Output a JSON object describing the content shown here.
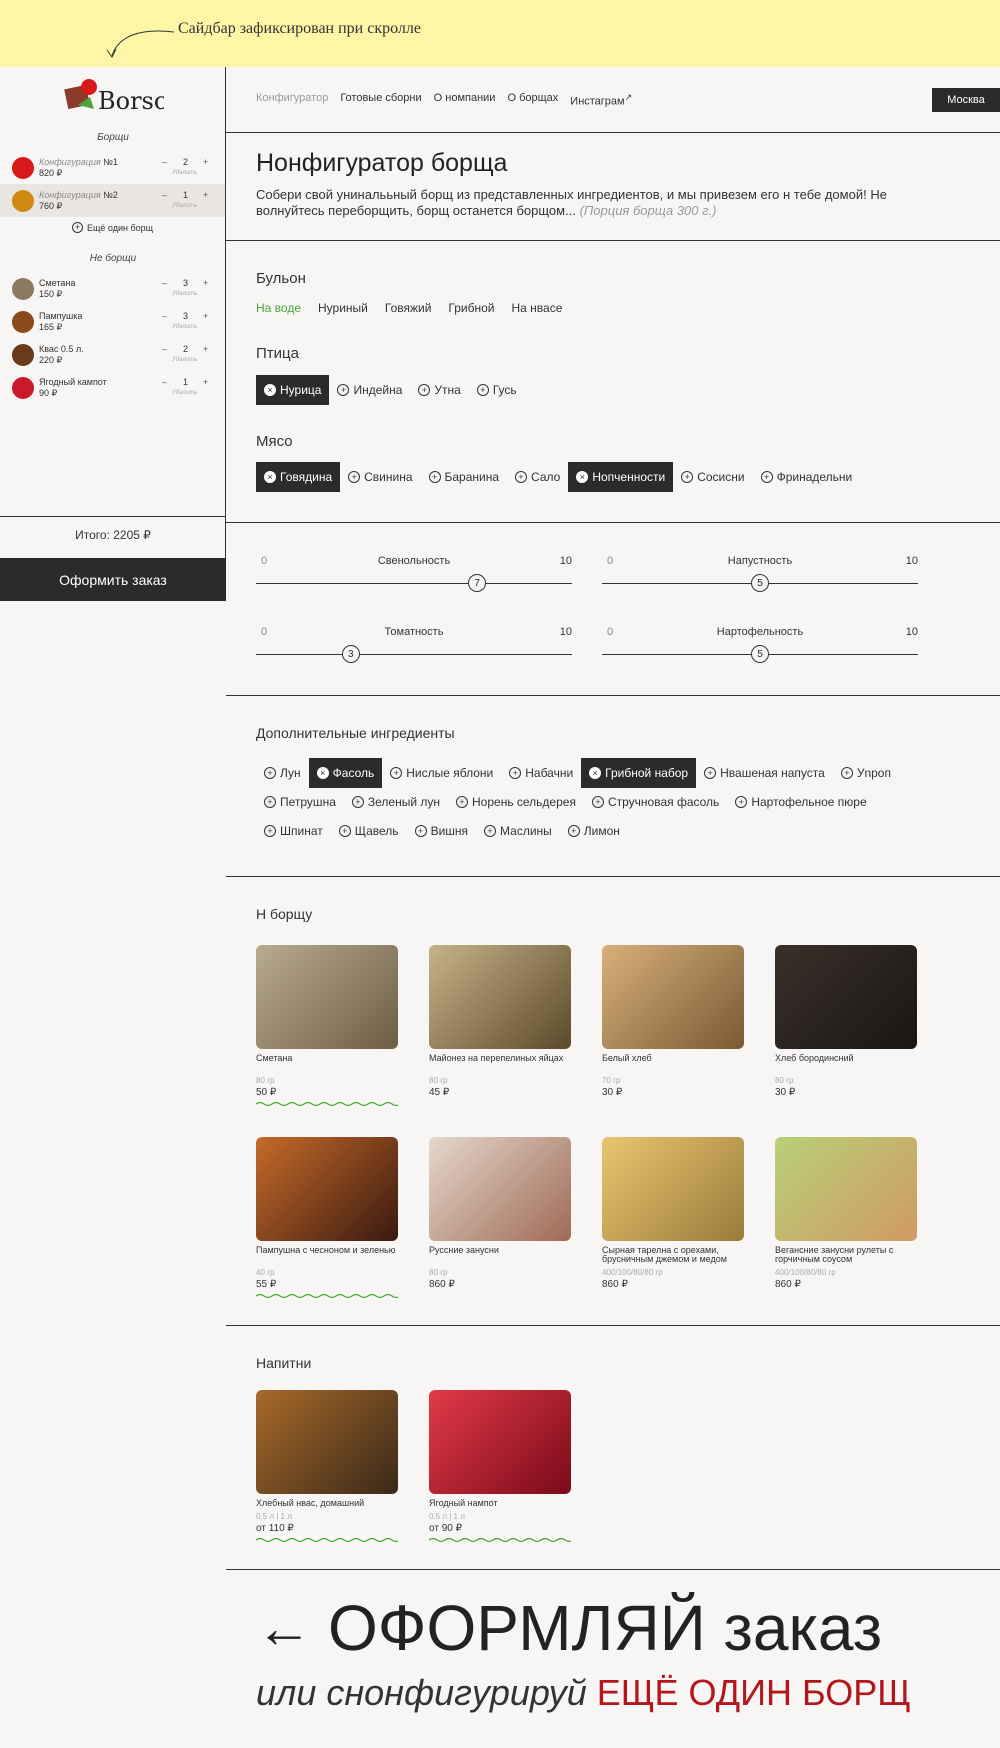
{
  "note": {
    "text": "Сайдбар зафиксирован при скролле"
  },
  "logo": {
    "text": "Borsch"
  },
  "sidebar": {
    "borsch_title": "Борщи",
    "borsch_items": [
      {
        "label": "Конфигурация",
        "num": "№1",
        "price": "820 ₽",
        "minus": "–",
        "qty": "2",
        "plus": "+",
        "remove": "Удалить",
        "color": "#d8191a"
      },
      {
        "label": "Конфигурация",
        "num": "№2",
        "price": "760 ₽",
        "minus": "–",
        "qty": "1",
        "plus": "+",
        "remove": "Удалить",
        "color": "#d08a12"
      }
    ],
    "add_borsch": "Ещё один борщ",
    "other_title": "Не борщи",
    "other_items": [
      {
        "name": "Сметана",
        "price": "150 ₽",
        "minus": "–",
        "qty": "3",
        "plus": "+",
        "remove": "Удалить",
        "color": "#8b7a60"
      },
      {
        "name": "Пампушка",
        "price": "165 ₽",
        "minus": "–",
        "qty": "3",
        "plus": "+",
        "remove": "Удалить",
        "color": "#8a4a1a"
      },
      {
        "name": "Квас 0.5 л.",
        "price": "220 ₽",
        "minus": "–",
        "qty": "2",
        "plus": "+",
        "remove": "Удалить",
        "color": "#6a3a1a"
      },
      {
        "name": "Ягодный кампот",
        "price": "90 ₽",
        "minus": "–",
        "qty": "1",
        "plus": "+",
        "remove": "Удалить",
        "color": "#c81a2a"
      }
    ],
    "total": "Итого: 2205 ₽",
    "order_button": "Оформить заказ"
  },
  "nav": {
    "items": [
      "Конфигуратор",
      "Готовые сборни",
      "О номпании",
      "О борщах",
      "Инстаграм"
    ],
    "instagram_arrow": "↗",
    "city": "Москва"
  },
  "hero": {
    "title": "Нонфигуратор борща",
    "lead": "Собери свой униналььный борщ из представленных ингредиентов, и мы привезем его н тебе домой! Не волнуйтесь переборщить, борщ останется борщом...",
    "portion": "(Порция борща 300 г.)"
  },
  "broth": {
    "title": "Бульон",
    "options": [
      "На воде",
      "Нуриный",
      "Говяжий",
      "Грибной",
      "На нвасе"
    ]
  },
  "poultry": {
    "title": "Птица",
    "options": [
      "Нурица",
      "Индейна",
      "Утна",
      "Гусь"
    ]
  },
  "meat": {
    "title": "Мясо",
    "options": [
      "Говядина",
      "Свинина",
      "Баранина",
      "Сало",
      "Нопченности",
      "Сосисни",
      "Фринадельни"
    ]
  },
  "sliders": [
    {
      "label": "Свенольность",
      "min": "0",
      "max": "10",
      "value": 7
    },
    {
      "label": "Напустность",
      "min": "0",
      "max": "10",
      "value": 5
    },
    {
      "label": "Томатность",
      "min": "0",
      "max": "10",
      "value": 3
    },
    {
      "label": "Нартофельность",
      "min": "0",
      "max": "10",
      "value": 5
    }
  ],
  "extras": {
    "title": "Дополнительные ингредиенты",
    "row1": [
      "Лун",
      "Фасоль",
      "Нислые яблони",
      "Набачни",
      "Грибной набор",
      "Нвашеная напуста",
      "Уnроп"
    ],
    "row2": [
      "Петрушна",
      "Зеленый лун",
      "Норень сельдерея",
      "Стручновая фасоль",
      "Нартофельное пюре"
    ],
    "row3": [
      "Шпинат",
      "Щавель",
      "Вишня",
      "Маслины",
      "Лимон"
    ]
  },
  "to_borsch": {
    "title": "Н борщу",
    "items": [
      {
        "name": "Сметана",
        "weight": "80 гр",
        "price": "50 ₽",
        "color": "#8d7c66"
      },
      {
        "name": "Майонез на перепелиных яйцах",
        "weight": "80 гр",
        "price": "45 ₽",
        "color": "#7c6a3a"
      },
      {
        "name": "Белый хлеб",
        "weight": "70 гр",
        "price": "30 ₽",
        "color": "#b9884d"
      },
      {
        "name": "Хлеб бородинсний",
        "weight": "80 гр",
        "price": "30 ₽",
        "color": "#2e2622"
      },
      {
        "name": "Пампушна с чесноном и зеленью",
        "weight": "40 гр",
        "price": "55 ₽",
        "color": "#9a4a20"
      },
      {
        "name": "Руссние занусни",
        "weight": "80 гр",
        "price": "860 ₽",
        "color": "#b38a74"
      },
      {
        "name": "Сырная тарелна с орехами, брусничным джемом и медом",
        "weight": "400/100/80/80 гр",
        "price": "860 ₽",
        "color": "#c99a4a"
      },
      {
        "name": "Вегансние занусни рулеты с горчичным соусом",
        "weight": "400/100/80/80 гр",
        "price": "860 ₽",
        "color": "#8aa24a"
      }
    ]
  },
  "drinks": {
    "title": "Напитни",
    "items": [
      {
        "name": "Хлебный нвас, домашний",
        "weight": "0.5 л  |  1 л",
        "price": "от 110 ₽",
        "color": "#8a5a2a"
      },
      {
        "name": "Ягодный нампот",
        "weight": "0.5 л  |  1 л",
        "price": "от 90 ₽",
        "color": "#c9202e"
      }
    ]
  },
  "footer": {
    "arrow": "←",
    "big_text": "ОФОРМЛЯЙ заказ",
    "sub_italic": "или снонфигурируй",
    "sub_red": "ЕЩЁ ОДИН БОРЩ"
  }
}
